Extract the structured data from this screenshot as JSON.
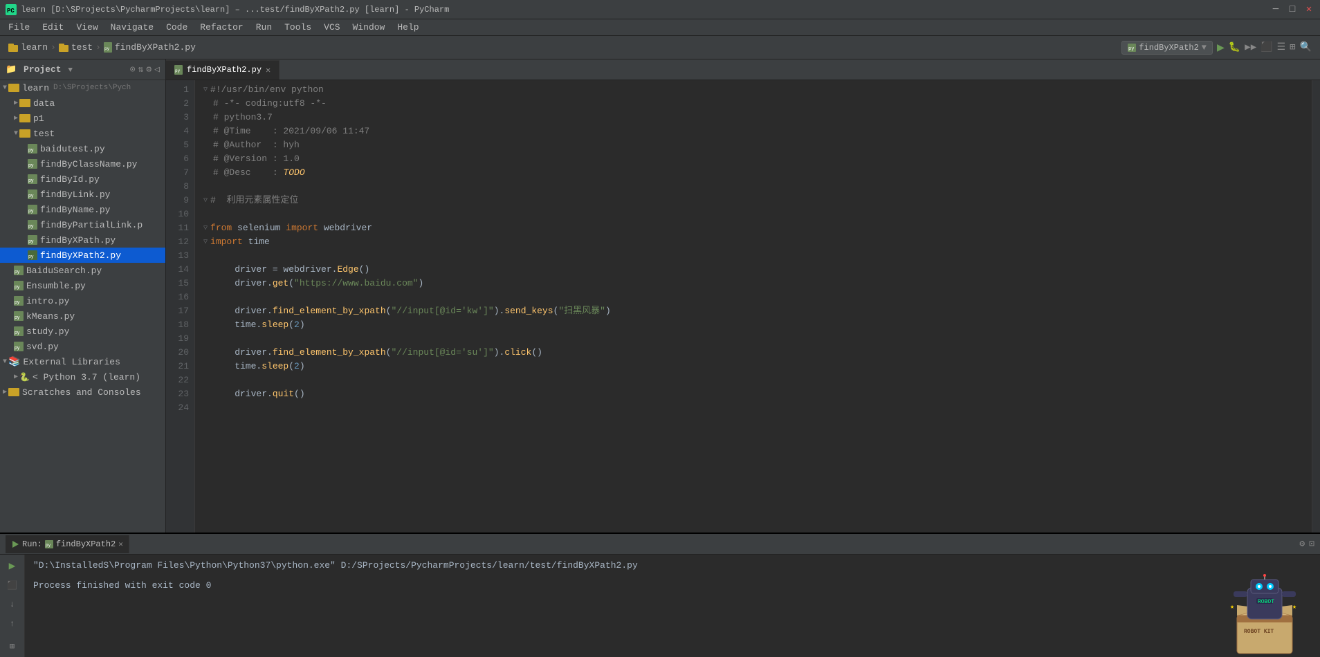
{
  "titleBar": {
    "title": "learn [D:\\SProjects\\PycharmProjects\\learn] – ...test/findByXPath2.py [learn] - PyCharm",
    "icon": "pycharm-icon"
  },
  "menuBar": {
    "items": [
      "File",
      "Edit",
      "View",
      "Navigate",
      "Code",
      "Refactor",
      "Run",
      "Tools",
      "VCS",
      "Window",
      "Help"
    ]
  },
  "navBar": {
    "breadcrumbs": [
      {
        "label": "learn",
        "type": "project"
      },
      {
        "label": "test",
        "type": "folder"
      },
      {
        "label": "findByXPath2.py",
        "type": "file"
      }
    ],
    "runConfig": "findByXPath2"
  },
  "sidebar": {
    "title": "Project",
    "items": [
      {
        "id": "learn-root",
        "label": "learn",
        "path": "D:\\SProjects\\Pych",
        "type": "folder",
        "indent": 0,
        "expanded": true
      },
      {
        "id": "data-folder",
        "label": "data",
        "type": "folder",
        "indent": 1,
        "expanded": false
      },
      {
        "id": "p1-folder",
        "label": "p1",
        "type": "folder",
        "indent": 1,
        "expanded": false
      },
      {
        "id": "test-folder",
        "label": "test",
        "type": "folder",
        "indent": 1,
        "expanded": true
      },
      {
        "id": "baidutest",
        "label": "baidutest.py",
        "type": "pyfile",
        "indent": 2
      },
      {
        "id": "findByClassName",
        "label": "findByClassName.py",
        "type": "pyfile",
        "indent": 2
      },
      {
        "id": "findById",
        "label": "findById.py",
        "type": "pyfile",
        "indent": 2
      },
      {
        "id": "findByLink",
        "label": "findByLink.py",
        "type": "pyfile",
        "indent": 2
      },
      {
        "id": "findByName",
        "label": "findByName.py",
        "type": "pyfile",
        "indent": 2
      },
      {
        "id": "findByPartialLink",
        "label": "findByPartialLink.p",
        "type": "pyfile",
        "indent": 2
      },
      {
        "id": "findByXPath",
        "label": "findByXPath.py",
        "type": "pyfile",
        "indent": 2
      },
      {
        "id": "findByXPath2",
        "label": "findByXPath2.py",
        "type": "pyfile",
        "indent": 2,
        "active": true
      },
      {
        "id": "BaiduSearch",
        "label": "BaiduSearch.py",
        "type": "pyfile",
        "indent": 1
      },
      {
        "id": "Ensumble",
        "label": "Ensumble.py",
        "type": "pyfile",
        "indent": 1
      },
      {
        "id": "intro",
        "label": "intro.py",
        "type": "pyfile",
        "indent": 1
      },
      {
        "id": "kMeans",
        "label": "kMeans.py",
        "type": "pyfile",
        "indent": 1
      },
      {
        "id": "study",
        "label": "study.py",
        "type": "pyfile",
        "indent": 1
      },
      {
        "id": "svd",
        "label": "svd.py",
        "type": "pyfile",
        "indent": 1
      },
      {
        "id": "ext-libs",
        "label": "External Libraries",
        "type": "extlib",
        "indent": 0,
        "expanded": false
      },
      {
        "id": "python37",
        "label": "< Python 3.7 (learn)",
        "type": "pyenv",
        "indent": 1
      },
      {
        "id": "scratches",
        "label": "Scratches and Consoles",
        "type": "folder",
        "indent": 0,
        "expanded": false
      }
    ]
  },
  "editor": {
    "tab": "findByXPath2.py",
    "lines": [
      {
        "num": 1,
        "fold": true,
        "html": "<span class='comment'>#!/usr/bin/env python</span>"
      },
      {
        "num": 2,
        "html": "<span class='comment'># -*- coding:utf8 -*-</span>"
      },
      {
        "num": 3,
        "html": "<span class='comment'># python3.7</span>"
      },
      {
        "num": 4,
        "html": "<span class='comment'># @Time    : 2021/09/06 11:47</span>"
      },
      {
        "num": 5,
        "html": "<span class='comment'># @Author  : hyh</span>"
      },
      {
        "num": 6,
        "html": "<span class='comment'># @Version : 1.0</span>"
      },
      {
        "num": 7,
        "html": "<span class='comment'># @Desc    : <span class='todo'>TODO</span></span>"
      },
      {
        "num": 8,
        "html": ""
      },
      {
        "num": 9,
        "fold": true,
        "html": "<span class='comment'>#  利用元素属性定位</span>"
      },
      {
        "num": 10,
        "html": ""
      },
      {
        "num": 11,
        "fold": true,
        "html": "<span class='kw'>from</span> <span class='plain'>selenium</span> <span class='kw'>import</span> <span class='plain'>webdriver</span>"
      },
      {
        "num": 12,
        "fold": true,
        "html": "<span class='kw'>import</span> <span class='plain'>time</span>"
      },
      {
        "num": 13,
        "html": ""
      },
      {
        "num": 14,
        "html": "    <span class='plain'>driver</span> <span class='plain'>=</span> <span class='plain'>webdriver</span><span class='plain'>.</span><span class='method'>Edge</span><span class='plain'>()</span>"
      },
      {
        "num": 15,
        "html": "    <span class='plain'>driver</span><span class='plain'>.</span><span class='method'>get</span><span class='plain'>(</span><span class='string'>\"https://www.baidu.com\"</span><span class='plain'>)</span>"
      },
      {
        "num": 16,
        "html": ""
      },
      {
        "num": 17,
        "html": "    <span class='plain'>driver</span><span class='plain'>.</span><span class='method'>find_element_by_xpath</span><span class='plain'>(</span><span class='string'>\"//input[@id='kw']\"</span><span class='plain'>).</span><span class='method'>send_keys</span><span class='plain'>(</span><span class='string'>\"扫黑风暴\"</span><span class='plain'>)</span>"
      },
      {
        "num": 18,
        "html": "    <span class='plain'>time</span><span class='plain'>.</span><span class='method'>sleep</span><span class='plain'>(</span><span class='number'>2</span><span class='plain'>)</span>"
      },
      {
        "num": 19,
        "html": ""
      },
      {
        "num": 20,
        "html": "    <span class='plain'>driver</span><span class='plain'>.</span><span class='method'>find_element_by_xpath</span><span class='plain'>(</span><span class='string'>\"//input[@id='su']\"</span><span class='plain'>).</span><span class='method'>click</span><span class='plain'>()</span>"
      },
      {
        "num": 21,
        "html": "    <span class='plain'>time</span><span class='plain'>.</span><span class='method'>sleep</span><span class='plain'>(</span><span class='number'>2</span><span class='plain'>)</span>"
      },
      {
        "num": 22,
        "html": ""
      },
      {
        "num": 23,
        "html": "    <span class='plain'>driver</span><span class='plain'>.</span><span class='method'>quit</span><span class='plain'>()</span>"
      },
      {
        "num": 24,
        "html": ""
      }
    ]
  },
  "bottomPanel": {
    "tabLabel": "findByXPath2",
    "runCommand": "\"D:\\InstalledS\\Program Files\\Python\\Python37\\python.exe\" D:/SProjects/PycharmProjects/learn/test/findByXPath2.py",
    "exitMessage": "Process finished with exit code 0"
  }
}
